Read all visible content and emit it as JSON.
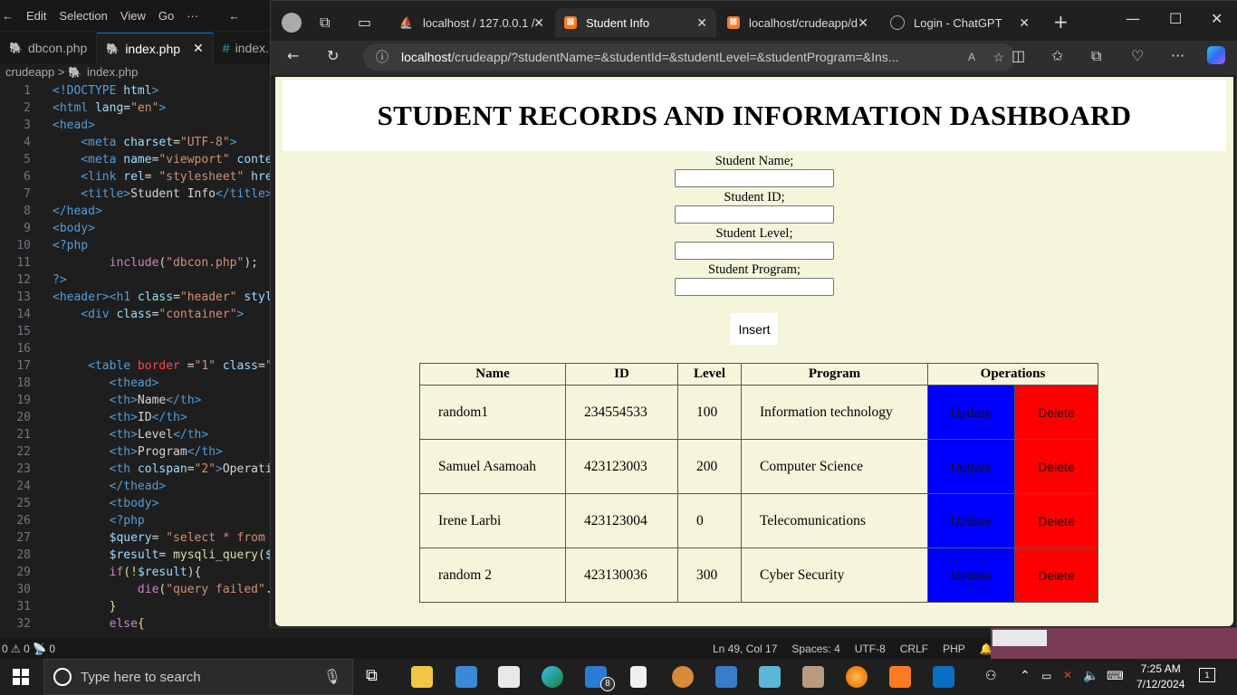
{
  "vscode": {
    "menu": [
      "Edit",
      "Selection",
      "View",
      "Go",
      "···"
    ],
    "tabs": [
      {
        "label": "dbcon.php"
      },
      {
        "label": "index.php"
      },
      {
        "label": "index."
      }
    ],
    "breadcrumb": {
      "folder": "crudeapp",
      "sep": ">",
      "file": "index.php"
    },
    "status": {
      "left": "0 ⚠ 0    📡 0",
      "position": "Ln 49, Col 17",
      "spaces": "Spaces: 4",
      "encoding": "UTF-8",
      "eol": "CRLF",
      "language": "PHP"
    }
  },
  "edge": {
    "tabs": [
      {
        "label": "localhost / 127.0.0.1 /"
      },
      {
        "label": "Student Info"
      },
      {
        "label": "localhost/crudeapp/d"
      },
      {
        "label": "Login - ChatGPT"
      }
    ],
    "url_host": "localhost",
    "url_rest": "/crudeapp/?studentName=&studentId=&studentLevel=&studentProgram=&Ins..."
  },
  "page": {
    "title": "STUDENT RECORDS AND INFORMATION DASHBOARD",
    "form": {
      "name_label": "Student Name;",
      "id_label": "Student ID;",
      "level_label": "Student Level;",
      "program_label": "Student Program;",
      "insert_label": "Insert"
    },
    "table": {
      "headers": [
        "Name",
        "ID",
        "Level",
        "Program",
        "Operations"
      ],
      "update_label": "Update",
      "delete_label": "Delete",
      "rows": [
        {
          "name": "random1",
          "id": "234554533",
          "level": "100",
          "program": "Information technology"
        },
        {
          "name": "Samuel Asamoah",
          "id": "423123003",
          "level": "200",
          "program": "Computer Science"
        },
        {
          "name": "Irene Larbi",
          "id": "423123004",
          "level": "0",
          "program": "Telecomunications"
        },
        {
          "name": "random 2",
          "id": "423130036",
          "level": "300",
          "program": "Cyber Security"
        }
      ]
    }
  },
  "taskbar": {
    "search_placeholder": "Type here to search",
    "time": "7:25 AM",
    "date": "7/12/2024",
    "mail_badge": "8",
    "notif_count": "1"
  }
}
